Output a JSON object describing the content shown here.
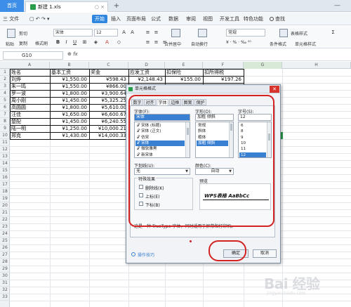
{
  "tabbar": {
    "home": "首页",
    "file_tab": "新建 1.xls",
    "add": "+"
  },
  "menubar": {
    "file": "三 文件",
    "start": "开始",
    "items": [
      "插入",
      "页面布局",
      "公式",
      "数据",
      "审阅",
      "视图",
      "开发工具",
      "特色功能"
    ],
    "search": "查找"
  },
  "ribbon": {
    "paste": "粘贴",
    "cut": "剪切",
    "format_painter": "格式刷",
    "copy": "复制",
    "font": "宋体",
    "size": "12",
    "merge": "合并居中",
    "wrap": "自动换行",
    "number_format": "常规",
    "cond_format": "条件格式",
    "table_style": "表格样式",
    "cell_style": "单元格样式"
  },
  "formula": {
    "namebox": "G10",
    "fx": "fx"
  },
  "grid": {
    "columns": [
      "A",
      "B",
      "C",
      "D",
      "E",
      "F",
      "G",
      "H"
    ],
    "rows": [
      "1",
      "2",
      "3",
      "4",
      "5",
      "6",
      "7",
      "8",
      "9",
      "10",
      "11",
      "12",
      "13",
      "14",
      "15",
      "16",
      "17",
      "18",
      "19",
      "20",
      "21",
      "22",
      "23",
      "24",
      "25",
      "26",
      "27",
      "28",
      "29",
      "30",
      "31",
      "32",
      "33"
    ],
    "headers": [
      "姓名",
      "基本工资",
      "奖金",
      "应发工资",
      "扣保险",
      "扣所得税"
    ],
    "data": [
      [
        "刘烨",
        "¥1,550.00",
        "¥598.43",
        "¥2,148.43",
        "¥155.00",
        "¥197.26"
      ],
      [
        "朱一鸣",
        "¥1,550.00",
        "¥866.00",
        "",
        "",
        ""
      ],
      [
        "罗一波",
        "¥1,800.00",
        "¥3,900.64",
        "",
        "",
        ""
      ],
      [
        "周小刚",
        "¥1,450.00",
        "¥5,325.25",
        "",
        "",
        ""
      ],
      [
        "高圆圆",
        "¥1,800.00",
        "¥5,610.00",
        "",
        "",
        ""
      ],
      [
        "汪佳",
        "¥1,650.00",
        "¥6,600.67",
        "",
        "",
        ""
      ],
      [
        "楚配",
        "¥1,450.00",
        "¥6,240.55",
        "",
        "",
        ""
      ],
      [
        "陆一明",
        "¥1,250.00",
        "¥10,000.21",
        "",
        "",
        ""
      ],
      [
        "郑克",
        "¥1,430.00",
        "¥14,000.33",
        "",
        "",
        ""
      ]
    ]
  },
  "dialog": {
    "title": "单元格格式",
    "close": "✕",
    "tabs": [
      "数字",
      "对齐",
      "字体",
      "边框",
      "图案",
      "保护"
    ],
    "font_label": "字体(F):",
    "font_value": "宋体",
    "fonts": [
      "宋体 (标题)",
      "宋体 (正文)",
      "仿宋",
      "宋体",
      "微软雅黑",
      "新宋体"
    ],
    "style_label": "字形(O):",
    "style_value": "加粗 倾斜",
    "styles": [
      "常规",
      "斜体",
      "粗体",
      "加粗 倾斜"
    ],
    "size_label": "字号(S):",
    "size_value": "12",
    "sizes": [
      "6",
      "8",
      "9",
      "10",
      "11",
      "12"
    ],
    "underline_label": "下划线(U):",
    "underline_value": "无",
    "color_label": "颜色(C):",
    "color_value": "自动",
    "effects_label": "特殊效果",
    "effects": [
      "删除线(K)",
      "上标(E)",
      "下标(B)"
    ],
    "preview_label": "预览",
    "preview_text": "WPS表格  AaBbCc",
    "hint": "这是一种 TrueType 字体，同时适用于屏幕和打印机。",
    "tips": "操作技巧",
    "ok": "确定",
    "cancel": "取消"
  },
  "watermark": {
    "text": "Bai 经验",
    "sub": "jingyan.baidu.com"
  }
}
